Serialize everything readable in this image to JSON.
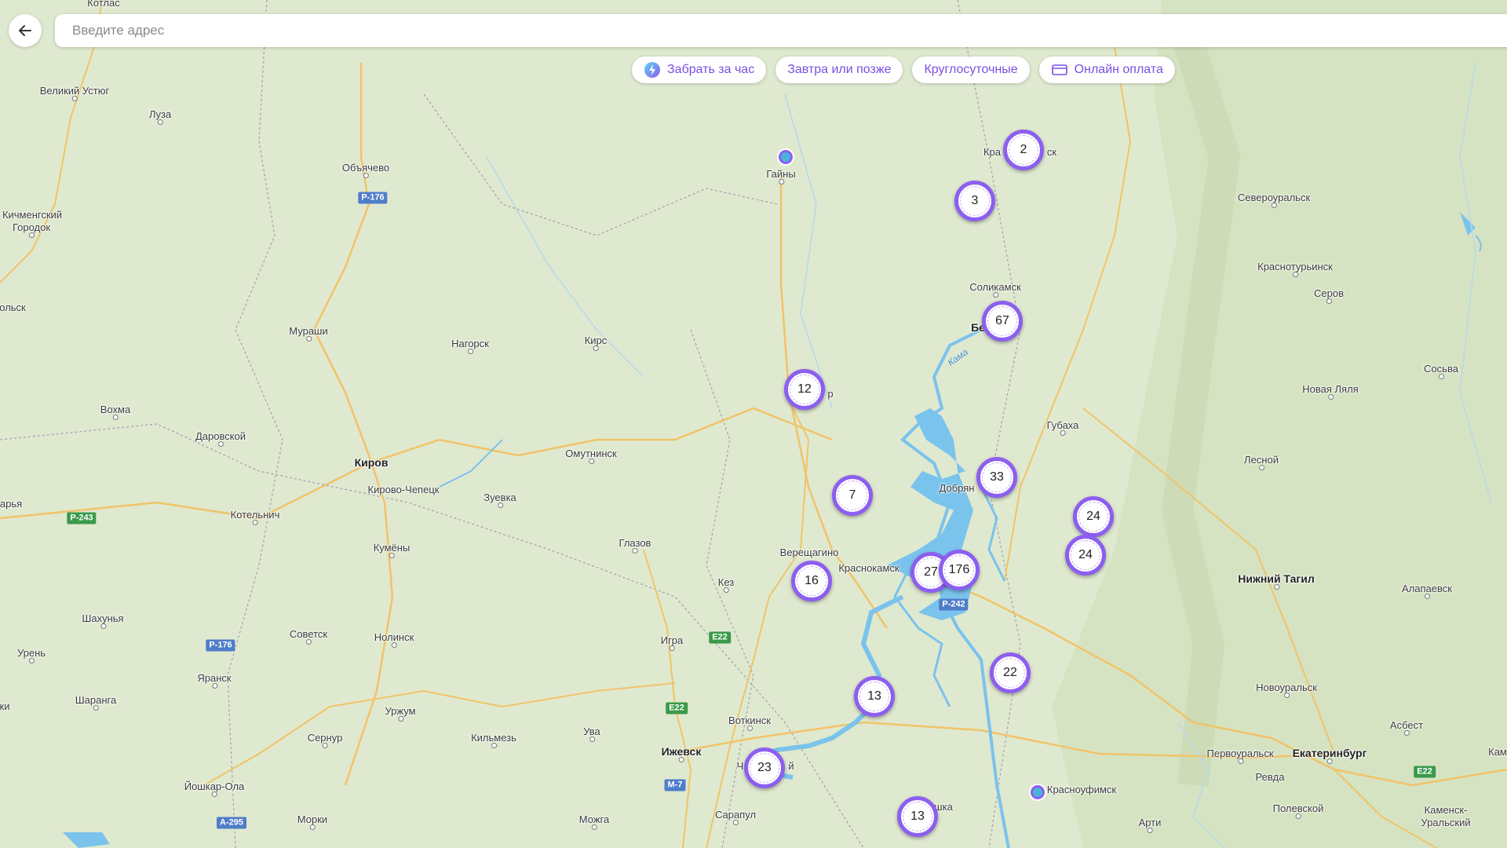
{
  "search": {
    "placeholder": "Введите адрес"
  },
  "filters": [
    {
      "label": "Забрать за час",
      "icon": "lightning-icon"
    },
    {
      "label": "Завтра или позже",
      "icon": ""
    },
    {
      "label": "Круглосуточные",
      "icon": ""
    },
    {
      "label": "Онлайн оплата",
      "icon": "card-icon"
    }
  ],
  "colors": {
    "accent": "#8c5ff0",
    "land": "#dfe9cf",
    "water": "#7ac3ec",
    "road": "#f1c36a",
    "pin": "#4ab4d8"
  },
  "places": {
    "kotlas": "Котлас",
    "velikiy_ustyug": "Великий Устюг",
    "luza": "Луза",
    "obyachevo": "Объячево",
    "kichmengsky": "Кичменгский",
    "gorodok": "Городок",
    "olsk": "ольск",
    "murashi": "Мураши",
    "nagorsk": "Нагорск",
    "kirs": "Кирс",
    "gayny": "Гайны",
    "kra": "Кра",
    "sk": "ск",
    "severouralsk": "Североуральск",
    "krasnoturinsk": "Краснотурьинск",
    "serov": "Серов",
    "solikamsk": "Соликамск",
    "be": "Бе",
    "sosva": "Сосьва",
    "novaya_lyalya": "Новая Ляля",
    "gubakha": "Губаха",
    "vokhma": "Вохма",
    "darovskoy": "Даровской",
    "kirov": "Киров",
    "kirovo_chepetsk": "Кирово-Чепецк",
    "omutninsk": "Омутнинск",
    "zuevka": "Зуевка",
    "kotelnich": "Котельнич",
    "arya": "арья",
    "kumeny": "Кумёны",
    "glazov": "Глазов",
    "vereshchagino": "Верещагино",
    "krasnokamsk": "Краснокамск",
    "kez": "Кез",
    "dobryan": "Добрян",
    "lesnoy": "Лесной",
    "nizhny_tagil": "Нижний Тагил",
    "alapaevsk": "Алапаевск",
    "shakhunya": "Шахунья",
    "sovetsk": "Советск",
    "nolinsk": "Нолинск",
    "igra": "Игра",
    "uren": "Урень",
    "yaransk": "Яранск",
    "sharanga": "Шаранга",
    "urzhum": "Уржум",
    "votkinsk": "Воткинск",
    "novouralsk": "Новоуральск",
    "sernur": "Сернур",
    "kilmez": "Кильмезь",
    "uva": "Ува",
    "izhevsk": "Ижевск",
    "pervouralsk": "Первоуральск",
    "ekaterinburg": "Екатеринбург",
    "asbest": "Асбест",
    "revda": "Ревда",
    "yoshkar_ola": "Йошкар-Ола",
    "krasnoufimsk": "Красноуфимск",
    "polevskoy": "Полевской",
    "kamensk": "Каменск-",
    "uralsky": "Уральский",
    "morki": "Морки",
    "mozhga": "Можга",
    "sarapul": "Сарапул",
    "arti": "Арти",
    "ki": "ки",
    "kam": "Кам",
    "ch": "Ч",
    "y": "й",
    "r": "р",
    "shka": "шка",
    "kama_river": "Кама"
  },
  "roads": {
    "r176a": "Р-176",
    "r176b": "Р-176",
    "r243": "Р-243",
    "r242": "Р-242",
    "e22a": "E22",
    "e22b": "E22",
    "e22c": "E22",
    "m7": "М-7",
    "a295": "А-295"
  },
  "clusters": {
    "c2": "2",
    "c3": "3",
    "c67": "67",
    "c12": "12",
    "c33": "33",
    "c7": "7",
    "c24a": "24",
    "c24b": "24",
    "c16": "16",
    "c27": "27",
    "c176": "176",
    "c22": "22",
    "c13a": "13",
    "c23": "23",
    "c13b": "13"
  }
}
